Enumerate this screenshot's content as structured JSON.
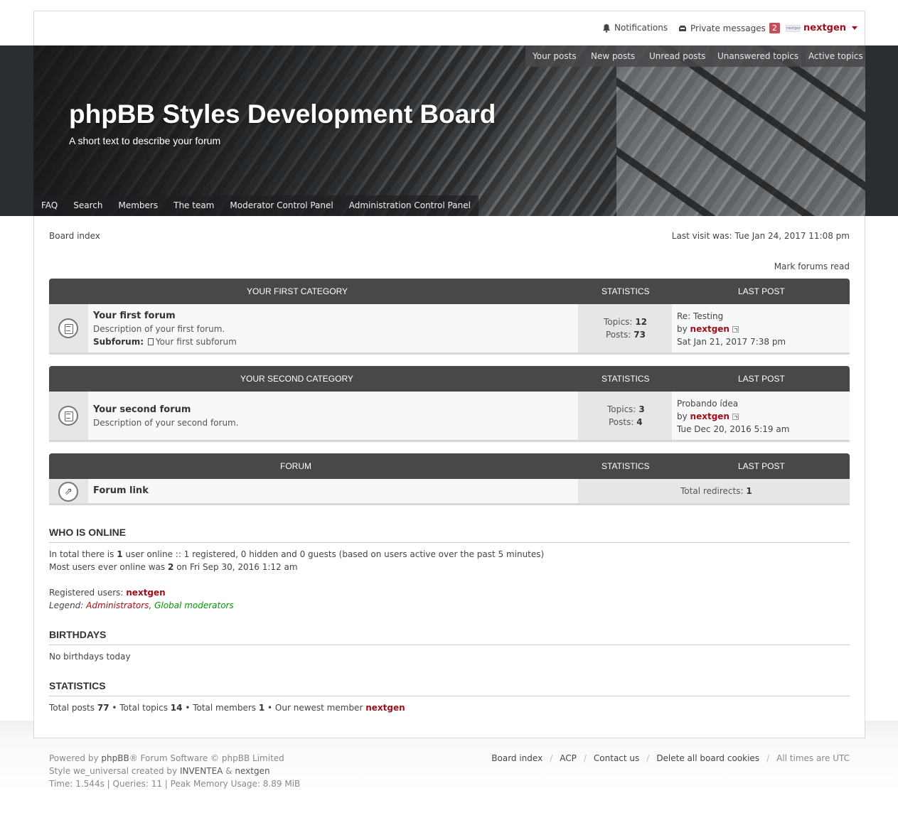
{
  "userbar": {
    "notifications": "Notifications",
    "private_messages": "Private messages",
    "pm_count": "2",
    "avatar_text": "nextgen",
    "username": "nextgen"
  },
  "quicklinks": [
    "Your posts",
    "New posts",
    "Unread posts",
    "Unanswered topics",
    "Active topics"
  ],
  "site": {
    "title": "phpBB Styles Development Board",
    "description": "A short text to describe your forum"
  },
  "navbar": [
    "FAQ",
    "Search",
    "Members",
    "The team",
    "Moderator Control Panel",
    "Administration Control Panel"
  ],
  "breadcrumb": "Board index",
  "last_visit": "Last visit was: Tue Jan 24, 2017 11:08 pm",
  "mark_read": "Mark forums read",
  "categories": [
    {
      "name": "YOUR FIRST CATEGORY",
      "stats_label": "STATISTICS",
      "lastpost_label": "LAST POST",
      "forum": {
        "title": "Your first forum",
        "description": "Description of your first forum.",
        "subforum_label": "Subforum:",
        "subforum": "Your first subforum",
        "topics_label": "Topics:",
        "topics": "12",
        "posts_label": "Posts:",
        "posts": "73",
        "last_title": "Re: Testing",
        "by": "by",
        "last_user": "nextgen",
        "last_date": "Sat Jan 21, 2017 7:38 pm"
      }
    },
    {
      "name": "YOUR SECOND CATEGORY",
      "stats_label": "STATISTICS",
      "lastpost_label": "LAST POST",
      "forum": {
        "title": "Your second forum",
        "description": "Description of your second forum.",
        "topics_label": "Topics:",
        "topics": "3",
        "posts_label": "Posts:",
        "posts": "4",
        "last_title": "Probando ídea",
        "by": "by",
        "last_user": "nextgen",
        "last_date": "Tue Dec 20, 2016 5:19 am"
      }
    },
    {
      "name": "FORUM",
      "stats_label": "STATISTICS",
      "lastpost_label": "LAST POST",
      "forum": {
        "title": "Forum link",
        "redirects_label": "Total redirects:",
        "redirects": "1"
      }
    }
  ],
  "who_is_online": {
    "heading": "WHO IS ONLINE",
    "line1_a": "In total there is",
    "line1_n": "1",
    "line1_b": "user online :: 1 registered, 0 hidden and 0 guests (based on users active over the past 5 minutes)",
    "line2_a": "Most users ever online was",
    "line2_n": "2",
    "line2_b": "on Fri Sep 30, 2016 1:12 am",
    "registered_label": "Registered users:",
    "registered_user": "nextgen",
    "legend_label": "Legend:",
    "legend_admins": "Administrators",
    "legend_sep": ",",
    "legend_gmods": "Global moderators"
  },
  "birthdays": {
    "heading": "BIRTHDAYS",
    "text": "No birthdays today"
  },
  "statistics": {
    "heading": "STATISTICS",
    "posts_label": "Total posts",
    "posts": "77",
    "topics_label": "• Total topics",
    "topics": "14",
    "members_label": "• Total members",
    "members": "1",
    "newest_label": "• Our newest member",
    "newest": "nextgen"
  },
  "footer": {
    "powered_a": "Powered by",
    "powered_phpbb": "phpBB",
    "powered_b": "® Forum Software © phpBB Limited",
    "style_a": "Style we_universal created by",
    "style_inventea": "INVENTEA",
    "style_amp": "&",
    "style_nextgen": "nextgen",
    "debug": "Time: 1.544s | Queries: 11 | Peak Memory Usage: 8.89 MiB",
    "nav": [
      "Board index",
      "ACP",
      "Contact us",
      "Delete all board cookies"
    ],
    "sep": "/",
    "timezone": "All times are UTC"
  },
  "colors": {
    "accent_red": "#a0101a",
    "global_mod_green": "#009900",
    "header_dark": "#484848",
    "pm_badge": "#c0505e"
  },
  "icons": [
    "bell-icon",
    "inbox-icon",
    "caret-down-icon",
    "forum-read-icon",
    "subforum-icon",
    "goto-post-icon",
    "forum-link-icon"
  ]
}
